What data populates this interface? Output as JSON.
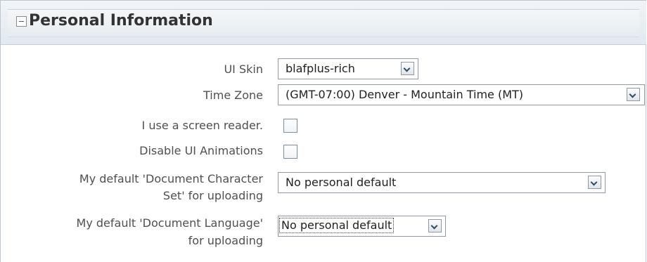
{
  "section": {
    "title": "Personal Information",
    "collapse_icon": "collapse-minus-icon"
  },
  "form": {
    "ui_skin": {
      "label": "UI Skin",
      "value": "blafplus-rich"
    },
    "time_zone": {
      "label": "Time Zone",
      "value": "(GMT-07:00) Denver - Mountain Time (MT)"
    },
    "screen_reader": {
      "label": "I use a screen reader.",
      "checked": false
    },
    "disable_animations": {
      "label": "Disable UI Animations",
      "checked": false
    },
    "doc_charset": {
      "label_line1": "My default 'Document Character",
      "label_line2": "Set' for uploading",
      "value": "No personal default"
    },
    "doc_language": {
      "label_line1": "My default 'Document Language'",
      "label_line2": "for uploading",
      "value": "No personal default"
    }
  },
  "colors": {
    "label_text": "#4f4f4f",
    "border": "#8f99a5",
    "header_bg": "#e6ecf1"
  }
}
